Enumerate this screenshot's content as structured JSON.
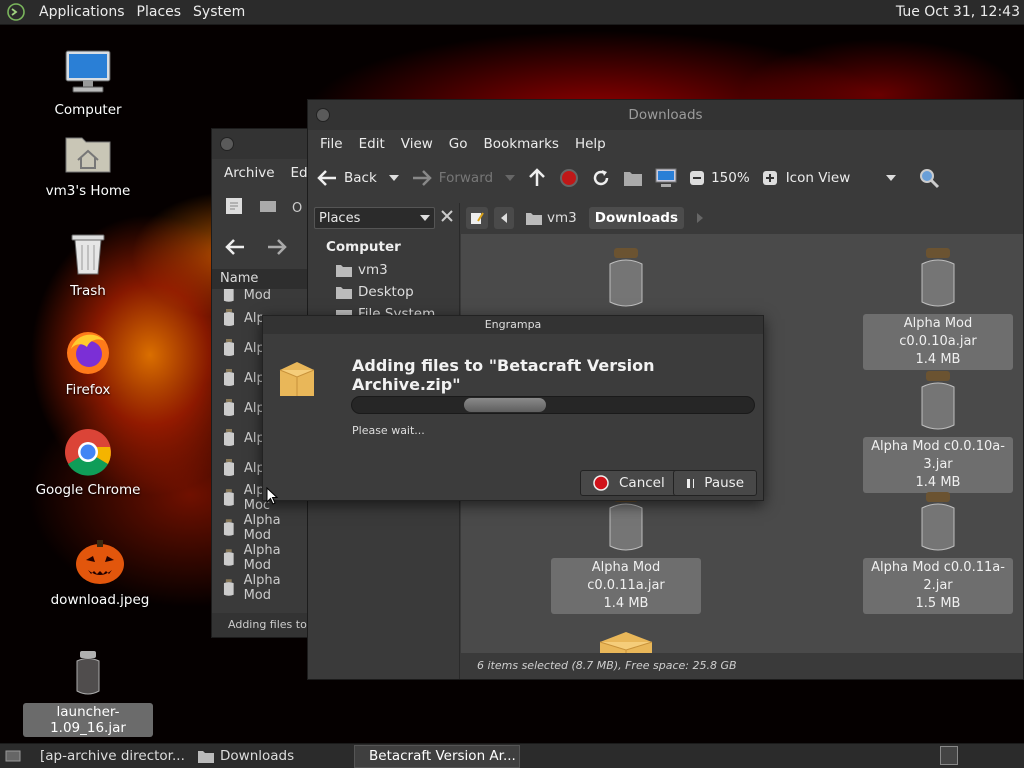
{
  "top_panel": {
    "menus": [
      "Applications",
      "Places",
      "System"
    ],
    "clock": "Tue Oct 31, 12:43"
  },
  "desktop": {
    "icons": [
      {
        "label": "Computer",
        "icon": "computer-icon"
      },
      {
        "label": "vm3's Home",
        "icon": "home-folder-icon"
      },
      {
        "label": "Trash",
        "icon": "trash-icon"
      },
      {
        "label": "Firefox",
        "icon": "firefox-icon"
      },
      {
        "label": "Google Chrome",
        "icon": "chrome-icon"
      },
      {
        "label": "download.jpeg",
        "icon": "image-file-icon"
      },
      {
        "label": "launcher-1.09_16.jar",
        "icon": "jar-file-icon",
        "selected": true
      }
    ]
  },
  "engrampa_main": {
    "menus": [
      "Archive",
      "Edi"
    ],
    "toolbar_partial_label": "O",
    "column_name": "Name",
    "rows": [
      "Alpha Mod",
      "Alp",
      "Alp",
      "Alp",
      "Alp",
      "Alp",
      "Alp",
      "Alpha Moc",
      "Alpha Mod",
      "Alpha Mod",
      "Alpha Mod"
    ],
    "status": "Adding files to \"E"
  },
  "caja": {
    "title": "Downloads",
    "menus": [
      "File",
      "Edit",
      "View",
      "Go",
      "Bookmarks",
      "Help"
    ],
    "toolbar": {
      "back": "Back",
      "forward": "Forward",
      "zoom": "150%",
      "view_mode": "Icon View"
    },
    "sidebar": {
      "combo": "Places",
      "section": "Computer",
      "items": [
        "vm3",
        "Desktop",
        "File System"
      ]
    },
    "path": [
      "vm3",
      "Downloads"
    ],
    "files": [
      {
        "name": "Alpha Mod c0.0.10a.jar",
        "size": "1.4 MB"
      },
      {
        "name": "Alpha Mod c0.0.10a-3.jar",
        "size": "1.4 MB"
      },
      {
        "name": "Alpha Mod c0.0.11a.jar",
        "size": "1.4 MB"
      },
      {
        "name": "Alpha Mod c0.0.11a-2.jar",
        "size": "1.5 MB"
      }
    ],
    "status": "6 items selected (8.7 MB), Free space: 25.8 GB"
  },
  "dialog": {
    "title": "Engrampa",
    "heading": "Adding files to \"Betacraft Version Archive.zip\"",
    "wait": "Please wait...",
    "cancel": "Cancel",
    "pause": "Pause"
  },
  "bottom_panel": {
    "tasks": [
      {
        "label": "[ap-archive director...",
        "icon": "chrome-icon"
      },
      {
        "label": "Downloads",
        "icon": "folder-icon"
      },
      {
        "label": "Betacraft Version Ar...",
        "icon": "archive-icon",
        "active": true
      }
    ]
  },
  "colors": {
    "panel": "#2b2b2b",
    "window": "#3a3a3a",
    "iconview": "#4a4a4a",
    "selection": "#6e6e6e",
    "cancel_red": "#d0121a"
  }
}
